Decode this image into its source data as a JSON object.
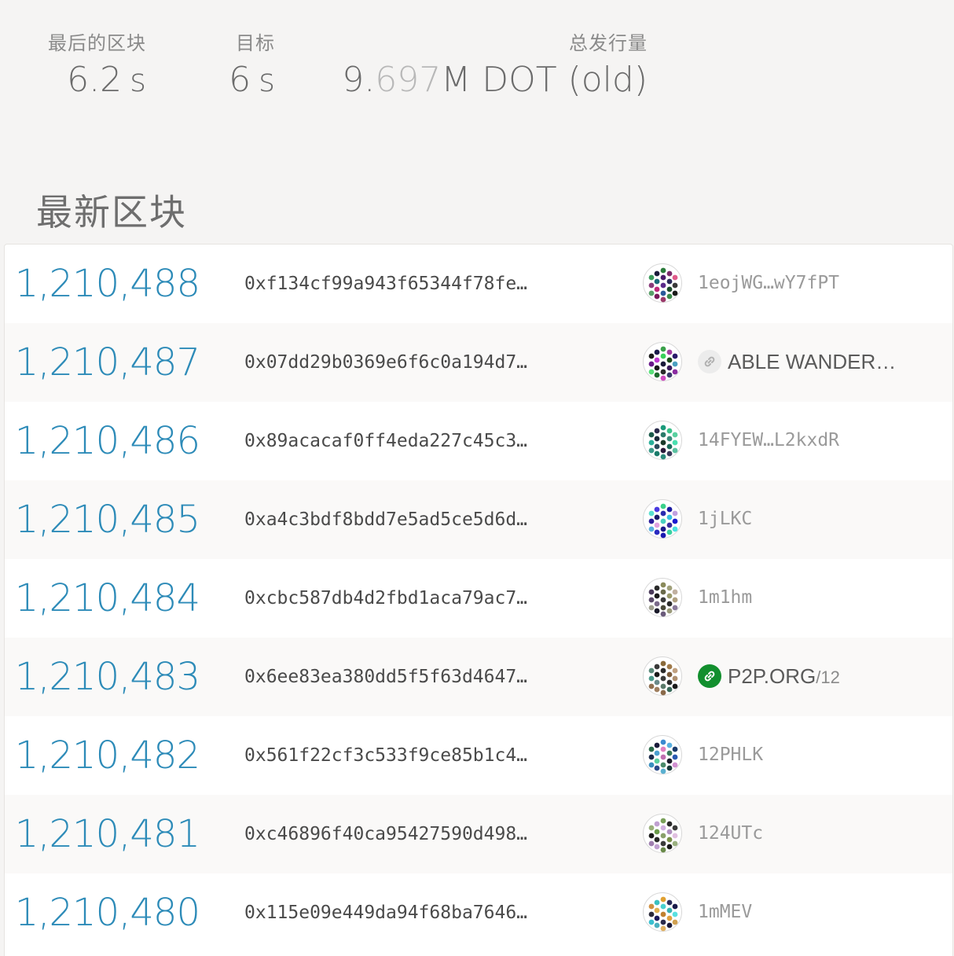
{
  "summary": {
    "last_block_label": "最后的区块",
    "last_block_value": "6.2",
    "last_block_unit": "s",
    "target_label": "目标",
    "target_value": "6",
    "target_unit": "s",
    "issuance_label": "总发行量",
    "issuance_value_main": "9.",
    "issuance_value_faded": "697",
    "issuance_value_suffix": "M DOT (old)"
  },
  "recent_blocks": {
    "title": "最新区块",
    "rows": [
      {
        "number": "1,210,488",
        "hash": "0xf134cf99a943f65344f78fe…",
        "author": "1eojWG…wY7fPT",
        "author_type": "address",
        "identicon_colors": [
          "#2a7a3a",
          "#1a1a3a",
          "#7a2a6a",
          "#3a9a5a",
          "#4a1a6a",
          "#e05a8a",
          "#1a6a7a",
          "#2a2a5a",
          "#8a3a7a",
          "#5a2a8a",
          "#3a3a3a",
          "#c02a7a",
          "#1a4a2a",
          "#5aa06a",
          "#2a5a9a",
          "#1a1a1a",
          "#7a1a5a",
          "#3a8a4a",
          "#9a3a6a"
        ]
      },
      {
        "number": "1,210,487",
        "hash": "0x07dd29b0369e6f6c0a194d7…",
        "author": "ABLE WANDER…",
        "author_type": "identity",
        "badge": "plain",
        "identicon_colors": [
          "#3aa04a",
          "#1a1a4a",
          "#a03aa0",
          "#1a1a1a",
          "#3ad05a",
          "#2a1a6a",
          "#c03ad0",
          "#1a4a1a",
          "#6a1a8a",
          "#1a1a3a",
          "#4aa0c0",
          "#1a1a1a",
          "#3a1a5a",
          "#5ae07a",
          "#2a2a2a",
          "#8a2aa0",
          "#1a6a2a",
          "#3a3a6a",
          "#d04ac0"
        ]
      },
      {
        "number": "1,210,486",
        "hash": "0x89acacaf0ff4eda227c45c3…",
        "author": "14FYEW…L2kxdR",
        "author_type": "address",
        "identicon_colors": [
          "#1a9a7a",
          "#2a2a4a",
          "#3ac08a",
          "#1a5a4a",
          "#2a7a6a",
          "#5ad0a0",
          "#1a2a3a",
          "#3a8a7a",
          "#2ab09a",
          "#1a3a2a",
          "#4ae0b0",
          "#2a4a5a",
          "#1a6a5a",
          "#3a9a8a",
          "#2a1a3a",
          "#5ac0a0",
          "#1a7a6a",
          "#3a3a5a",
          "#2a8a7a"
        ]
      },
      {
        "number": "1,210,485",
        "hash": "0xa4c3bdf8bdd7e5ad5ce5d6d…",
        "author": "1jLKC",
        "author_type": "address",
        "identicon_colors": [
          "#3ad08a",
          "#4a3ae0",
          "#1a1aa0",
          "#5ae0d0",
          "#2a2ab0",
          "#c0a0e0",
          "#1a1a6a",
          "#3ac0e0",
          "#2a1a9a",
          "#4ad0c0",
          "#1a1ad0",
          "#e0a0e0",
          "#3a2aa0",
          "#5ab0e0",
          "#1a1a8a",
          "#4ae0e0",
          "#2a2ac0",
          "#3ad0a0",
          "#1a1ab0"
        ]
      },
      {
        "number": "1,210,484",
        "hash": "0xcbc587db4d2fbd1aca79ac7…",
        "author": "1m1hm",
        "author_type": "address",
        "identicon_colors": [
          "#8a8a5a",
          "#2a2a2a",
          "#a0a07a",
          "#4a3a5a",
          "#6a6a4a",
          "#c0b0a0",
          "#1a1a1a",
          "#9a9a6a",
          "#5a4a6a",
          "#3a3a3a",
          "#b0a080",
          "#7a6a8a",
          "#2a2a2a",
          "#a0a090",
          "#4a4a3a",
          "#8a7a9a",
          "#1a1a2a",
          "#9a9a7a",
          "#6a5a7a"
        ]
      },
      {
        "number": "1,210,483",
        "hash": "0x6ee83ea380dd5f5f63d4647…",
        "author": "P2P.ORG",
        "author_sub": "/12",
        "author_type": "identity",
        "badge": "verified",
        "identicon_colors": [
          "#8a6a3a",
          "#3a3a3a",
          "#a07a4a",
          "#5a8a7a",
          "#2a2a2a",
          "#c0a080",
          "#1a1a1a",
          "#7a5a3a",
          "#4a9a8a",
          "#3a3a3a",
          "#b09070",
          "#6a8a8a",
          "#2a2a2a",
          "#907050",
          "#5a7a6a",
          "#1a1a1a",
          "#a08060",
          "#3a6a5a",
          "#8a6a4a"
        ]
      },
      {
        "number": "1,210,482",
        "hash": "0x561f22cf3c533f9ce85b1c4…",
        "author": "12PHLK",
        "author_type": "address",
        "identicon_colors": [
          "#3a8ad0",
          "#1a1a3a",
          "#5ab0e0",
          "#2a6a4a",
          "#e080c0",
          "#1a3a6a",
          "#4aa0d0",
          "#3a7a5a",
          "#1a2a4a",
          "#c070b0",
          "#2a5ab0",
          "#5ad0a0",
          "#1a1a2a",
          "#3a90c0",
          "#4a8a6a",
          "#d090d0",
          "#2a4a8a",
          "#1a3a3a",
          "#5ab0d0"
        ]
      },
      {
        "number": "1,210,481",
        "hash": "0xc46896f40ca95427590d498…",
        "author": "124UTc",
        "author_type": "address",
        "identicon_colors": [
          "#7aa05a",
          "#c0a0d0",
          "#2a2a2a",
          "#9ab07a",
          "#d0b0e0",
          "#3a3a3a",
          "#6a9a4a",
          "#b090c0",
          "#1a1a1a",
          "#8aa06a",
          "#e0c0e0",
          "#2a2a2a",
          "#7a904a",
          "#a080b0",
          "#3a3a3a",
          "#9ab080",
          "#c0a0d0",
          "#1a1a1a",
          "#6a8a4a"
        ]
      },
      {
        "number": "1,210,480",
        "hash": "0x115e09e449da94f68ba7646…",
        "author": "1mMEV",
        "author_type": "address",
        "identicon_colors": [
          "#e0a030",
          "#3ac0c0",
          "#2a2a5a",
          "#d09040",
          "#4ad0d0",
          "#1a1a4a",
          "#e0b050",
          "#3ab0b0",
          "#2a2a3a",
          "#c08030",
          "#5ae0e0",
          "#1a1a5a",
          "#e0a040",
          "#3ac0d0",
          "#2a2a4a",
          "#d0a050",
          "#4ab0c0",
          "#1a1a3a",
          "#e0b060"
        ]
      }
    ]
  }
}
